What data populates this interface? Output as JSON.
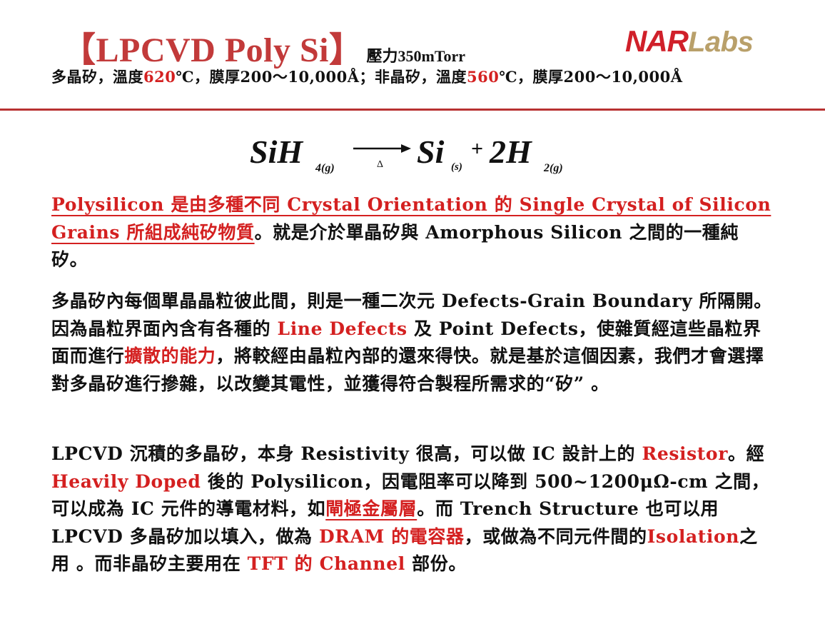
{
  "header": {
    "title": "【LPCVD Poly Si】",
    "pressure": "壓力350mTorr",
    "logo_nar": "NAR",
    "logo_labs": "Labs",
    "subtitle": {
      "s1": "多晶矽，溫度",
      "t1": "620",
      "s2": "℃，膜厚200～10,000Å；非晶矽，溫度",
      "t2": "560",
      "s3": "℃，膜厚200～10,000Å"
    }
  },
  "equation": {
    "reactant": "SiH",
    "reactant_sub": "4(g)",
    "condition": "Δ",
    "product1": "Si",
    "product1_sub": "(s)",
    "plus": "+",
    "product2": "2H",
    "product2_sub": "2(g)"
  },
  "para1": {
    "red_underlined": "Polysilicon 是由多種不同 Crystal Orientation 的 Single Crystal of Silicon Grains 所組成純矽物質",
    "rest": "。就是介於單晶矽與 Amorphous Silicon 之間的一種純矽。"
  },
  "para2": {
    "t1": "多晶矽內每個單晶晶粒彼此間，則是一種二次元 Defects-Grain Boundary 所隔開。因為晶粒界面內含有各種的 ",
    "r1": "Line Defects",
    "t2": " 及 Point Defects，使雜質經這些晶粒界面而進行",
    "r2": "擴散的能力",
    "t3": "，將較經由晶粒內部的還來得快。就是基於這個因素，我們才會選擇對多晶矽進行摻雜，以改變其電性，並獲得符合製程所需求的“矽” 。"
  },
  "para3": {
    "t1": "LPCVD 沉積的多晶矽，本身 Resistivity 很高，可以做 IC 設計上的 ",
    "r1": "Resistor",
    "t2": "。經 ",
    "r2": "Heavily Doped",
    "t3": " 後的 Polysilicon，因電阻率可以降到 500~1200μΩ-cm 之間，可以成為 IC 元件的導電材料，如",
    "r3": "閘極金屬層",
    "t4": "。而 Trench Structure 也可以用 LPCVD 多晶矽加以填入，做為 ",
    "r4": "DRAM 的電容器",
    "t5": "，或做為不同元件間的",
    "r5": "Isolation",
    "t6": "之用 。而非晶矽主要用在 ",
    "r6": "TFT 的 Channel",
    "t7": " 部份。"
  },
  "colors": {
    "title": "#c23a3a",
    "accent_red": "#d42020",
    "rule": "#b83232",
    "logo_red": "#d0202a",
    "logo_gold": "#b9a06a"
  }
}
